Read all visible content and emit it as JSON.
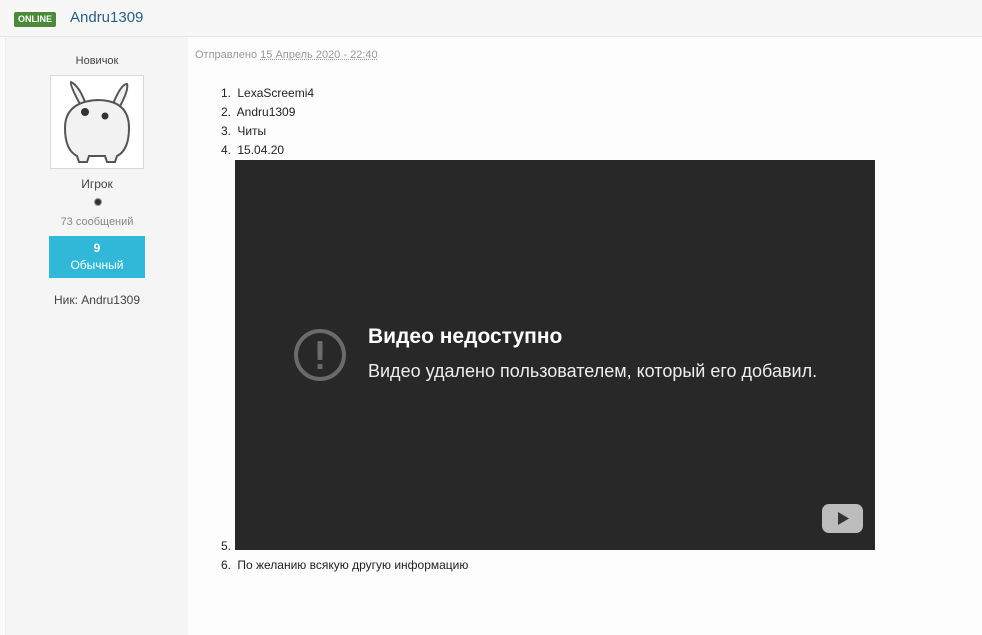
{
  "header": {
    "online_badge": "ONLINE",
    "author_name": "Andru1309"
  },
  "profile": {
    "rank_title": "Новичок",
    "avatar_icon": "avatar-creature-icon",
    "group": "Игрок",
    "post_count": "73 сообщений",
    "reputation_value": "9",
    "reputation_label": "Обычный",
    "nick": "Ник: Andru1309"
  },
  "post": {
    "posted_prefix": "Отправлено",
    "posted_date": "15 Апрель 2020 - 22:40",
    "items": [
      {
        "num": "1.",
        "text": "LexaScreemi4"
      },
      {
        "num": "2.",
        "text": "Andru1309"
      },
      {
        "num": "3.",
        "text": "Читы"
      },
      {
        "num": "4.",
        "text": "15.04.20"
      },
      {
        "num": "5.",
        "text": ""
      },
      {
        "num": "6.",
        "text": "По желанию всякую другую информацию"
      }
    ],
    "video": {
      "title": "Видео недоступно",
      "message": "Видео удалено пользователем, который его добавил.",
      "warning_icon": "exclamation-circle-icon",
      "logo_icon": "youtube-play-icon"
    }
  },
  "colors": {
    "online_badge": "#4a8a3a",
    "author_link": "#2a5f86",
    "reputation_box": "#31b7d8",
    "video_bg": "#282828"
  }
}
